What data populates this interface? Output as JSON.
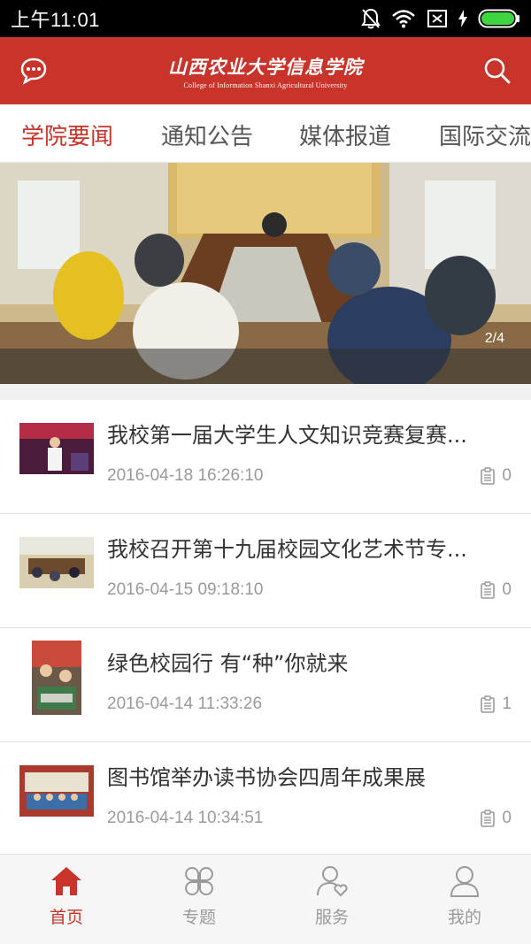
{
  "status_bar": {
    "time": "上午11:01"
  },
  "header": {
    "title_cn": "山西农业大学信息学院",
    "title_en": "College of Information Shanxi Agricultural University",
    "chat_icon": "chat-bubble-icon",
    "search_icon": "search-icon"
  },
  "tabs": [
    {
      "label": "学院要闻",
      "active": true
    },
    {
      "label": "通知公告",
      "active": false
    },
    {
      "label": "媒体报道",
      "active": false
    },
    {
      "label": "国际交流",
      "active": false
    }
  ],
  "banner": {
    "counter": "2/4"
  },
  "news": [
    {
      "title": "我校第一届大学生人文知识竞赛复赛...",
      "date": "2016-04-18 16:26:10",
      "comments": "0"
    },
    {
      "title": "我校召开第十九届校园文化艺术节专...",
      "date": "2016-04-15 09:18:10",
      "comments": "0"
    },
    {
      "title": "绿色校园行 有“种”你就来",
      "date": "2016-04-14 11:33:26",
      "comments": "1"
    },
    {
      "title": "图书馆举办读书协会四周年成果展",
      "date": "2016-04-14 10:34:51",
      "comments": "0"
    }
  ],
  "bottom_nav": [
    {
      "label": "首页",
      "icon": "home-icon",
      "active": true
    },
    {
      "label": "专题",
      "icon": "clover-icon",
      "active": false
    },
    {
      "label": "服务",
      "icon": "user-heart-icon",
      "active": false
    },
    {
      "label": "我的",
      "icon": "profile-icon",
      "active": false
    }
  ],
  "colors": {
    "brand": "#c8332a",
    "muted": "#9a9a9a"
  }
}
